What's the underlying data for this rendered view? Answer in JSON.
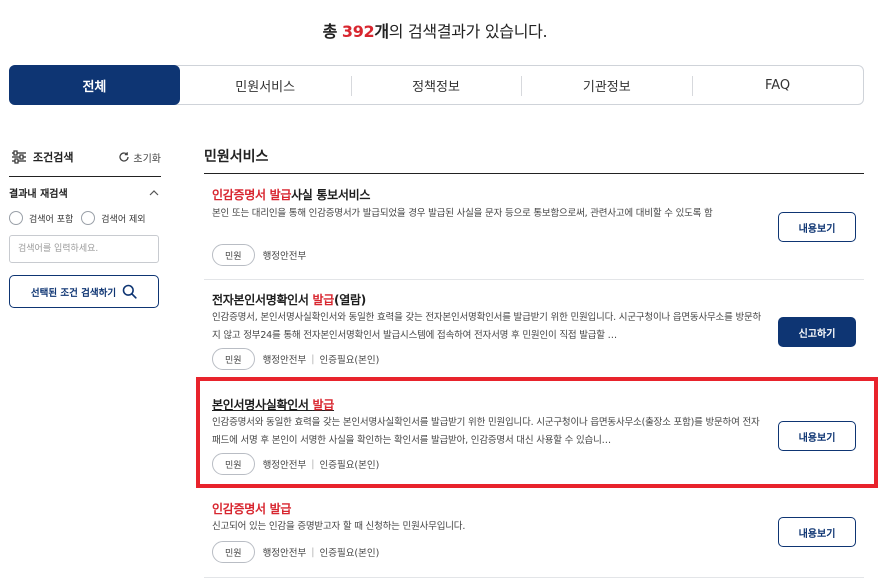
{
  "summary": {
    "prefix": "총",
    "count": "392",
    "unit": "개",
    "suffix": "의 검색결과가 있습니다."
  },
  "tabs": [
    {
      "label": "전체",
      "active": true
    },
    {
      "label": "민원서비스",
      "active": false
    },
    {
      "label": "정책정보",
      "active": false
    },
    {
      "label": "기관정보",
      "active": false
    },
    {
      "label": "FAQ",
      "active": false
    }
  ],
  "sidebar": {
    "filter_title": "조건검색",
    "reset_label": "초기화",
    "research_title": "결과내 재검색",
    "radio_include": "검색어 포함",
    "radio_exclude": "검색어 제외",
    "keyword_placeholder": "검색어를 입력하세요.",
    "search_button": "선택된 조건 검색하기"
  },
  "main": {
    "section_title": "민원서비스",
    "items": [
      {
        "title_hl": "인감증명서 발급",
        "title_rest": "사실 통보서비스",
        "desc": "본인 또는 대리인을 통해 인감증명서가 발급되었을 경우 발급된 사실을 문자 등으로 통보함으로써, 관련사고에 대비할 수 있도록 함",
        "badge": "민원",
        "org": "행정안전부",
        "auth": "",
        "button": "내용보기"
      },
      {
        "title_pre": "전자본인서명확인서 ",
        "title_hl": "발급",
        "title_rest": "(열람)",
        "desc": "인감증명서, 본인서명사실확인서와 동일한 효력을 갖는 전자본인서명확인서를 발급받기 위한 민원입니다. 시군구청이나 읍면동사무소를 방문하지 않고 정부24를 통해 전자본인서명확인서 발급시스템에 접속하여 전자서명 후 민원인이 직접 발급할 …",
        "badge": "민원",
        "org": "행정안전부",
        "auth": "인증필요(본인)",
        "button": "신고하기"
      },
      {
        "title_pre": "본인서명사실확인서 ",
        "title_hl": "발급",
        "desc": "인감증명서와 동일한 효력을 갖는 본인서명사실확인서를 발급받기 위한 민원입니다. 시군구청이나 읍면동사무소(출장소 포함)를 방문하여 전자패드에 서명 후 본인이 서명한 사실을 확인하는 확인서를 발급받아, 인감증명서 대신 사용할 수 있습니…",
        "badge": "민원",
        "org": "행정안전부",
        "auth": "인증필요(본인)",
        "button": "내용보기"
      },
      {
        "title_hl": "인감증명서 발급",
        "desc": "신고되어 있는 인감을 증명받고자 할 때 신청하는 민원사무입니다.",
        "badge": "민원",
        "org": "행정안전부",
        "auth": "인증필요(본인)",
        "button": "내용보기"
      }
    ]
  },
  "colors": {
    "primary": "#0e3573",
    "highlight": "#d8262f",
    "box": "#e8232c"
  }
}
